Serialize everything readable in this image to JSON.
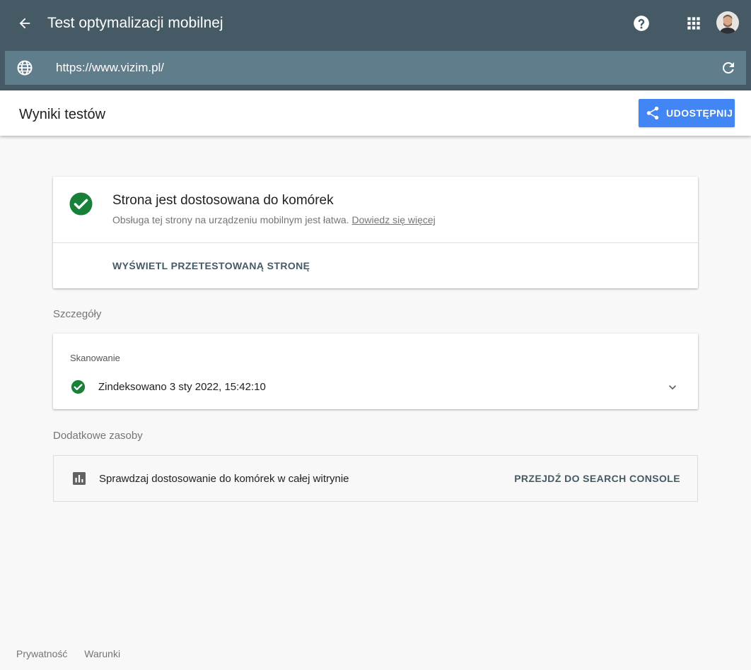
{
  "header": {
    "title": "Test optymalizacji mobilnej",
    "back_icon": "arrow-back-icon",
    "help_icon": "help-circle-icon",
    "apps_icon": "apps-grid-icon",
    "avatar_icon": "user-avatar"
  },
  "urlbar": {
    "url": "https://www.vizim.pl/",
    "globe_icon": "globe-icon",
    "reload_icon": "reload-icon"
  },
  "subheader": {
    "title": "Wyniki testów",
    "share_label": "UDOSTĘPNIJ",
    "share_color": "#4285f4"
  },
  "result": {
    "title": "Strona jest dostosowana do komórek",
    "description": "Obsługa tej strony na urządzeniu mobilnym jest łatwa.",
    "learn_more": "Dowiedz się więcej",
    "view_tested_page": "WYŚWIETL PRZETESTOWANĄ STRONĘ",
    "status_color": "#188038"
  },
  "details": {
    "section_label": "Szczegóły",
    "scan_label": "Skanowanie",
    "scan_status": "Zindeksowano 3 sty 2022, 15:42:10"
  },
  "resources": {
    "section_label": "Dodatkowe zasoby",
    "text": "Sprawdzaj dostosowanie do komórek w całej witrynie",
    "link": "PRZEJDŹ DO SEARCH CONSOLE"
  },
  "footer": {
    "privacy": "Prywatność",
    "terms": "Warunki"
  },
  "colors": {
    "topbar": "#455a64",
    "urlbar": "#607d8b",
    "background": "#f8f8f8"
  }
}
